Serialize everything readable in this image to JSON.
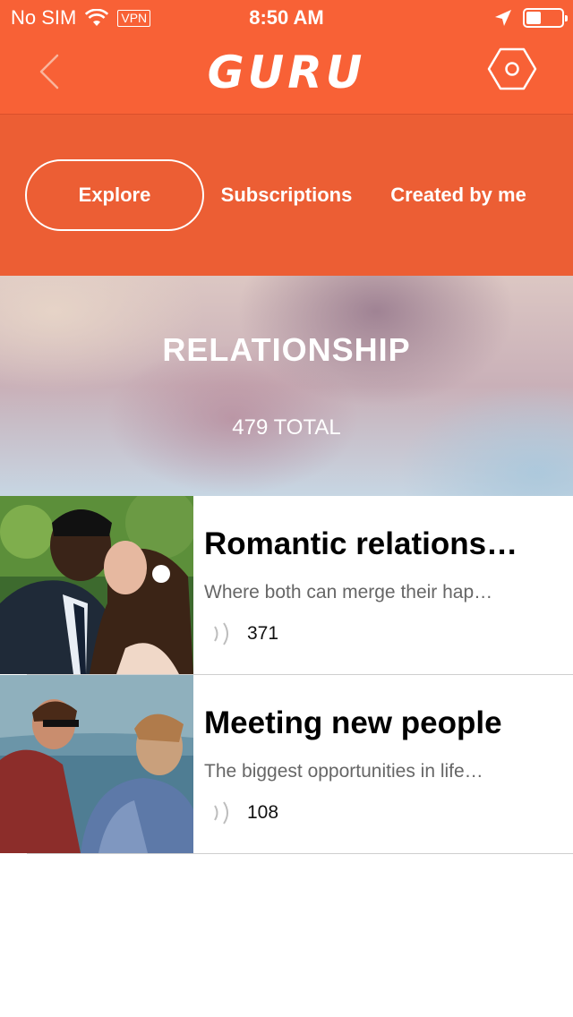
{
  "status": {
    "carrier": "No SIM",
    "vpn": "VPN",
    "time": "8:50 AM"
  },
  "nav": {
    "logo": "GURU",
    "back_icon": "chevron-left-icon",
    "settings_icon": "hexagon-gear-icon"
  },
  "tabs": [
    {
      "label": "Explore",
      "active": true
    },
    {
      "label": "Subscriptions",
      "active": false
    },
    {
      "label": "Created by me",
      "active": false
    }
  ],
  "hero": {
    "title": "RELATIONSHIP",
    "total": "479 TOTAL"
  },
  "items": [
    {
      "title": "Romantic relations…",
      "subtitle": "Where both can merge their hap…",
      "count": "371"
    },
    {
      "title": "Meeting new people",
      "subtitle": "The biggest opportunities in life…",
      "count": "108"
    }
  ],
  "colors": {
    "accent": "#f86136",
    "tab_bar": "#ec5e34"
  }
}
